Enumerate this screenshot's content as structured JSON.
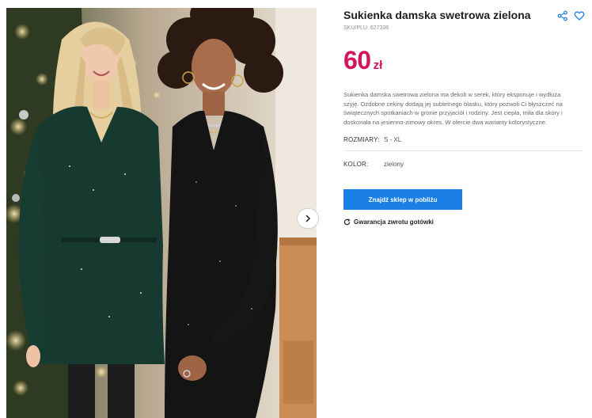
{
  "product": {
    "title": "Sukienka damska swetrowa zielona",
    "sku": "SKU/PLU: 627336",
    "price": {
      "amount": "60",
      "currency": "zł"
    },
    "description_lines": [
      "Sukienka damska swetrowa zielona ma dekolt w serek, który eksponuje i wydłuża",
      "szyję. Ozdobne cekiny dodają jej subtelnego blasku, który pozwoli Ci błyszczeć na",
      "świątecznych spotkaniach w gronie przyjaciół i rodziny. Jest ciepła, miła dla skóry i",
      "doskonała na jesienno-zimowy okres. W ofercie dwa warianty kolorystyczne."
    ],
    "attributes": {
      "sizes_label": "ROZMIARY:",
      "sizes_value": "S - XL",
      "color_label": "KOLOR:",
      "color_value": "zielony"
    }
  },
  "actions": {
    "find_store_label": "Znajdź sklep w pobliżu",
    "guarantee_label": "Gwarancja zwrotu gotówki"
  },
  "icons": {
    "share": "share-icon",
    "favorite": "heart-icon",
    "next": "chevron-right-icon",
    "guarantee": "refresh-icon"
  },
  "colors": {
    "price": "#d4145a",
    "cta_background": "#1a7fe6",
    "favorite_icon": "#1a7fe6"
  }
}
